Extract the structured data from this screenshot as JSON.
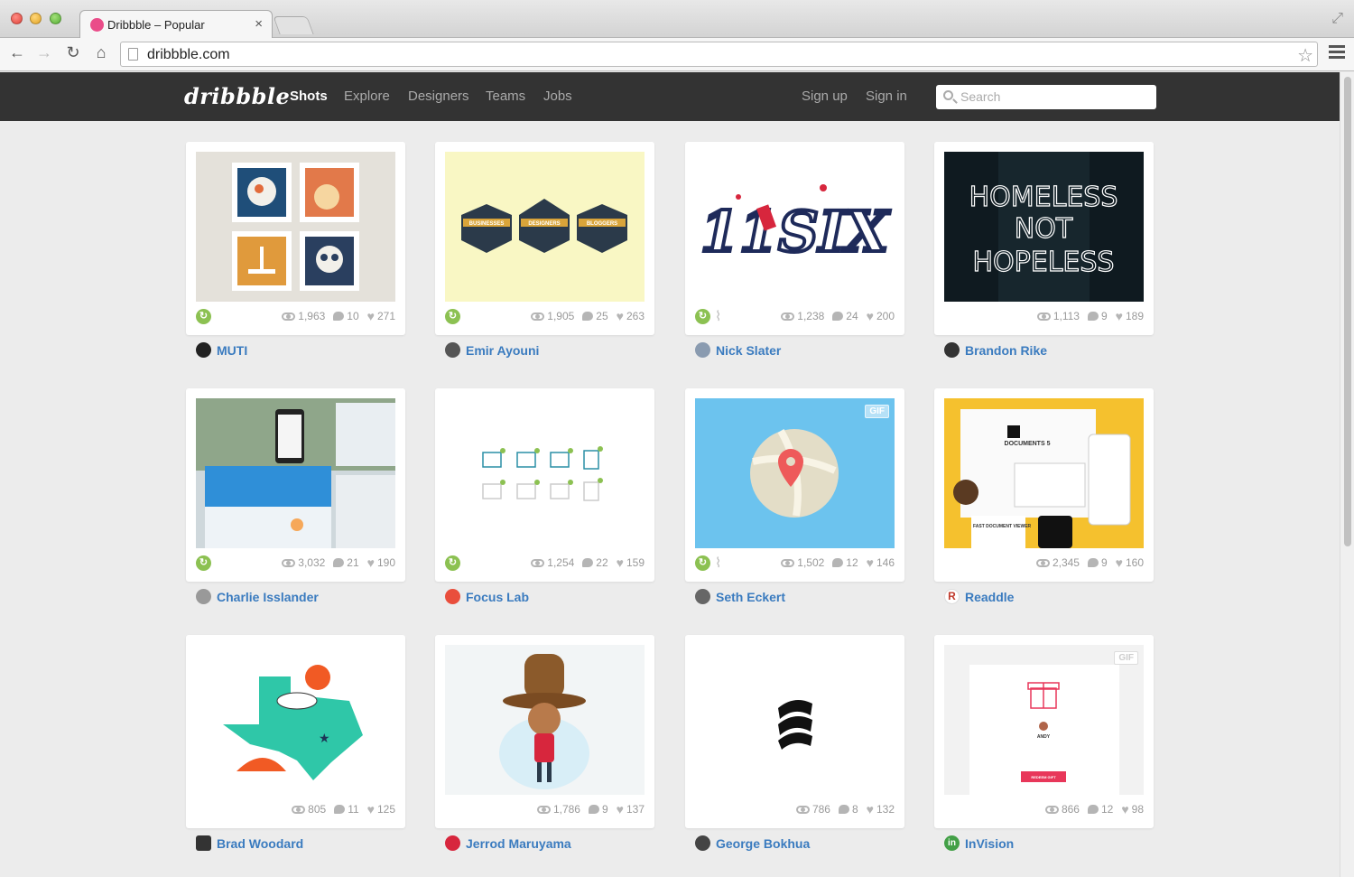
{
  "browser": {
    "tab_title": "Dribbble – Popular",
    "url": "dribbble.com"
  },
  "header": {
    "logo": "dribbble",
    "nav": [
      "Shots",
      "Explore",
      "Designers",
      "Teams",
      "Jobs"
    ],
    "sign_up": "Sign up",
    "sign_in": "Sign in",
    "search_placeholder": "Search"
  },
  "shots": [
    {
      "player": "MUTI",
      "views": "1,963",
      "comments": "10",
      "likes": "271",
      "rebound": true,
      "attachment": false,
      "gif": false
    },
    {
      "player": "Emir Ayouni",
      "views": "1,905",
      "comments": "25",
      "likes": "263",
      "rebound": true,
      "attachment": false,
      "gif": false
    },
    {
      "player": "Nick Slater",
      "views": "1,238",
      "comments": "24",
      "likes": "200",
      "rebound": true,
      "attachment": true,
      "gif": false
    },
    {
      "player": "Brandon Rike",
      "views": "1,113",
      "comments": "9",
      "likes": "189",
      "rebound": false,
      "attachment": false,
      "gif": false
    },
    {
      "player": "Charlie Isslander",
      "views": "3,032",
      "comments": "21",
      "likes": "190",
      "rebound": true,
      "attachment": false,
      "gif": false
    },
    {
      "player": "Focus Lab",
      "views": "1,254",
      "comments": "22",
      "likes": "159",
      "rebound": true,
      "attachment": false,
      "gif": false
    },
    {
      "player": "Seth Eckert",
      "views": "1,502",
      "comments": "12",
      "likes": "146",
      "rebound": true,
      "attachment": true,
      "gif": true,
      "gif_label": "GIF"
    },
    {
      "player": "Readdle",
      "views": "2,345",
      "comments": "9",
      "likes": "160",
      "rebound": false,
      "attachment": false,
      "gif": false
    },
    {
      "player": "Brad Woodard",
      "views": "805",
      "comments": "11",
      "likes": "125",
      "rebound": false,
      "attachment": false,
      "gif": false
    },
    {
      "player": "Jerrod Maruyama",
      "views": "1,786",
      "comments": "9",
      "likes": "137",
      "rebound": false,
      "attachment": false,
      "gif": false
    },
    {
      "player": "George Bokhua",
      "views": "786",
      "comments": "8",
      "likes": "132",
      "rebound": false,
      "attachment": false,
      "gif": false
    },
    {
      "player": "InVision",
      "views": "866",
      "comments": "12",
      "likes": "98",
      "rebound": false,
      "attachment": false,
      "gif": true,
      "gif_label": "GIF"
    }
  ],
  "artwork_text": {
    "badges": [
      "BUSINESSES",
      "DESIGNERS",
      "BLOGGERS"
    ],
    "homeless": [
      "HOMELESS",
      "NOT",
      "HOPELESS"
    ],
    "elevensix": "11SIX",
    "readdle_doc": "DOCUMENTS 5",
    "readdle_viewer": "FAST DOCUMENT VIEWER",
    "invision_name": "ANDY",
    "invision_button": "REDEEM GIFT"
  },
  "colors": {
    "header_bg": "#333333",
    "player_link": "#3a7bbf",
    "rebound": "#8cc152",
    "dribbble_pink": "#ea4c89"
  }
}
